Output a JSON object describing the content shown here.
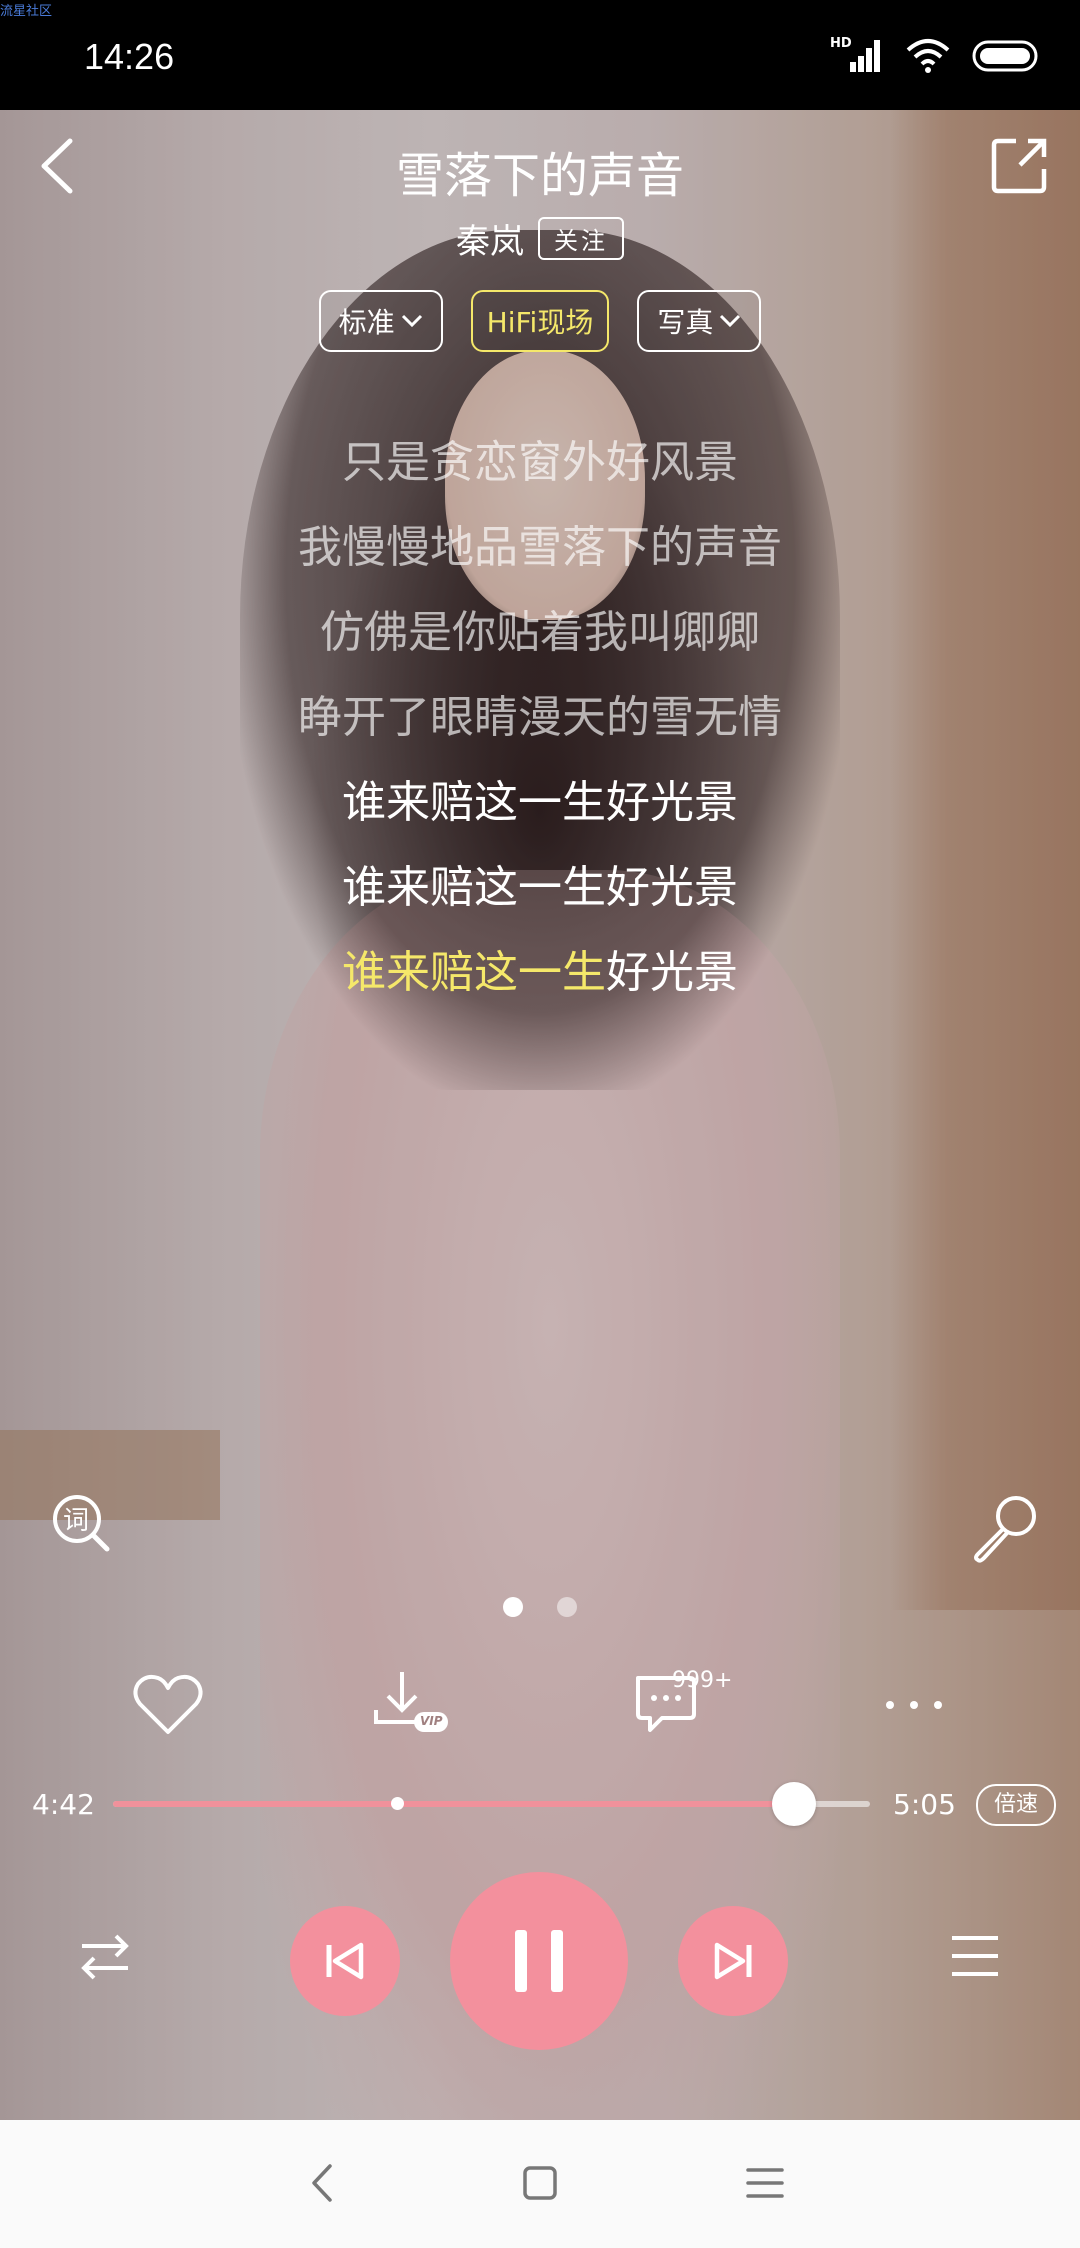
{
  "status_bar": {
    "watermark": "流星社区",
    "time": "14:26",
    "network_badge": "HD",
    "icons": [
      "signal-icon",
      "wifi-icon",
      "battery-icon"
    ]
  },
  "header": {
    "back_icon": "chevron-left-icon",
    "title": "雪落下的声音",
    "share_icon": "share-icon"
  },
  "artist": {
    "name": "秦岚",
    "follow_label": "关注"
  },
  "modes": {
    "quality_label": "标准",
    "hifi_label": "HiFi现场",
    "visual_label": "写真"
  },
  "lyrics": {
    "lines": [
      "只是贪恋窗外好风景",
      "我慢慢地品雪落下的声音",
      "仿佛是你贴着我叫卿卿",
      "睁开了眼睛漫天的雪无情",
      "谁来赔这一生好光景",
      "谁来赔这一生好光景"
    ],
    "current_sung": "谁来赔这一生",
    "current_rest": "好光景"
  },
  "side_tools": {
    "lyrics_search_icon": "lyrics-search-icon",
    "lyrics_search_glyph": "词",
    "mic_icon": "microphone-icon"
  },
  "pager": {
    "pages": 2,
    "active_index": 0
  },
  "actions": {
    "like_icon": "heart-icon",
    "download_icon": "vip-download-icon",
    "download_badge": "VIP",
    "comment_icon": "comment-icon",
    "comment_count": "999+",
    "more_icon": "more-icon"
  },
  "progress": {
    "elapsed": "4:42",
    "duration": "5:05",
    "played_fraction": 0.9,
    "buffered_fraction": 0.375,
    "speed_label": "倍速"
  },
  "playback": {
    "mode_icon": "shuffle-icon",
    "prev_icon": "skip-previous-icon",
    "play_pause_icon": "pause-icon",
    "next_icon": "skip-next-icon",
    "playlist_icon": "playlist-icon",
    "accent_color": "#f3909d",
    "highlight_color": "#f5e86a"
  },
  "nav_bar": {
    "back_icon": "nav-back-icon",
    "home_icon": "nav-home-icon",
    "menu_icon": "nav-menu-icon"
  }
}
